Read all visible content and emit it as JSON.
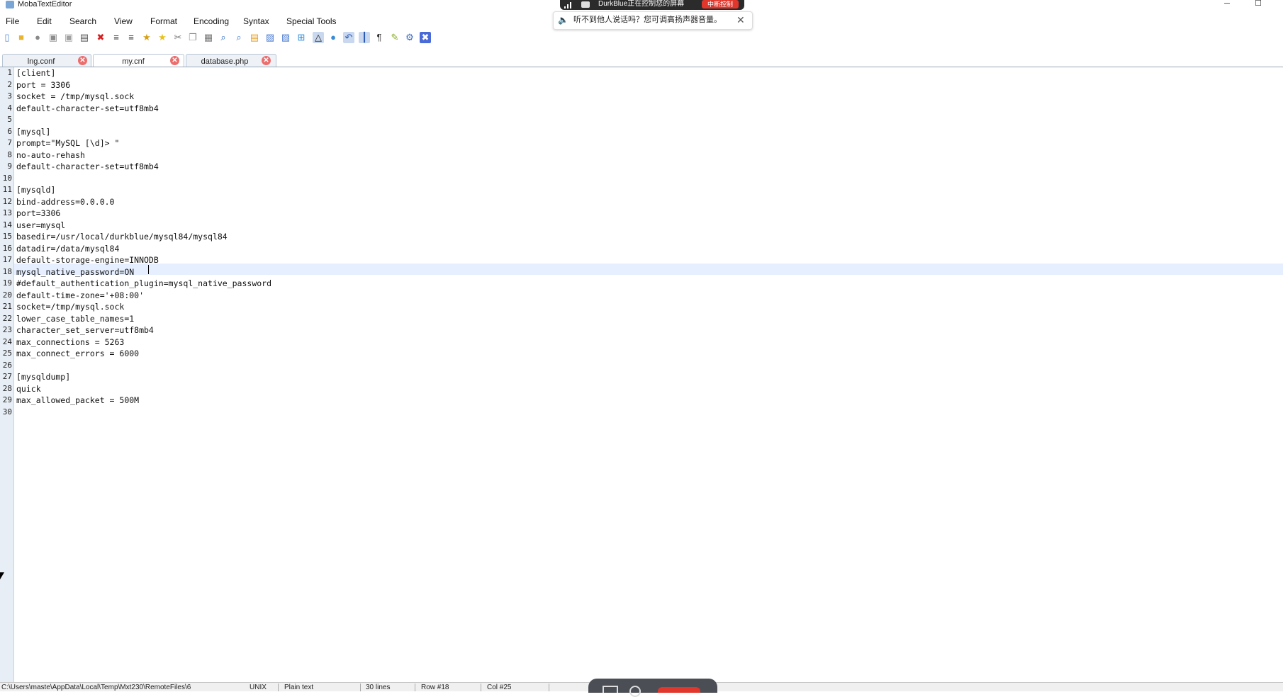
{
  "window": {
    "title": "MobaTextEditor",
    "minimize_glyph": "─",
    "maximize_glyph": "☐"
  },
  "screen_share": {
    "text": "DurkBlue正在控制您的屏幕",
    "stop_label": "中断控制"
  },
  "audio_notice": {
    "text": "听不到他人说话吗？您可调高扬声器音量。",
    "icon": "speaker-muted-icon",
    "icon_glyph": "🔈",
    "close_glyph": "✕"
  },
  "menu": [
    {
      "label": "File"
    },
    {
      "label": "Edit"
    },
    {
      "label": "Search"
    },
    {
      "label": "View"
    },
    {
      "label": "Format"
    },
    {
      "label": "Encoding"
    },
    {
      "label": "Syntax"
    },
    {
      "label": "Special Tools"
    }
  ],
  "toolbar": [
    {
      "name": "new-file-icon",
      "glyph": "▯",
      "color": "#5b8fd6"
    },
    {
      "name": "open-folder-icon",
      "glyph": "■",
      "color": "#e8b431"
    },
    {
      "name": "disk-icon",
      "glyph": "●",
      "color": "#8a8a8a"
    },
    {
      "name": "save-icon",
      "glyph": "▣",
      "color": "#8b8b8b"
    },
    {
      "name": "save-all-icon",
      "glyph": "▣",
      "color": "#a0a0a0"
    },
    {
      "name": "print-icon",
      "glyph": "▤",
      "color": "#555"
    },
    {
      "name": "close-file-icon",
      "glyph": "✖",
      "color": "#d42020"
    },
    {
      "name": "outdent-icon",
      "glyph": "≡",
      "color": "#333"
    },
    {
      "name": "indent-icon",
      "glyph": "≡",
      "color": "#333"
    },
    {
      "name": "bookmark-icon",
      "glyph": "★",
      "color": "#d4a017"
    },
    {
      "name": "bookmark-next-icon",
      "glyph": "★",
      "color": "#e8c020"
    },
    {
      "name": "cut-icon",
      "glyph": "✂",
      "color": "#777"
    },
    {
      "name": "copy-icon",
      "glyph": "❐",
      "color": "#888"
    },
    {
      "name": "paste-icon",
      "glyph": "▦",
      "color": "#777"
    },
    {
      "name": "find-icon",
      "glyph": "⌕",
      "color": "#2a6ac4"
    },
    {
      "name": "find-next-icon",
      "glyph": "⌕",
      "color": "#3a7ad4"
    },
    {
      "name": "replace-icon",
      "glyph": "▤",
      "color": "#e8a020"
    },
    {
      "name": "goto-icon",
      "glyph": "▨",
      "color": "#4a7ad0"
    },
    {
      "name": "compare-icon",
      "glyph": "▨",
      "color": "#4a7ad0"
    },
    {
      "name": "windows-eol-icon",
      "glyph": "⊞",
      "color": "#2a8ad4"
    },
    {
      "name": "linux-eol-icon",
      "glyph": "△",
      "color": "#222"
    },
    {
      "name": "mac-eol-icon",
      "glyph": "●",
      "color": "#3a8ad6"
    },
    {
      "name": "word-wrap-icon",
      "glyph": "↶",
      "color": "#2a5ab4"
    },
    {
      "name": "ruler-icon",
      "glyph": "┃",
      "color": "#2a5ab4"
    },
    {
      "name": "paragraph-icon",
      "glyph": "¶",
      "color": "#333"
    },
    {
      "name": "highlight-icon",
      "glyph": "✎",
      "color": "#8ab020"
    },
    {
      "name": "settings-icon",
      "glyph": "⚙",
      "color": "#3a6ac0"
    },
    {
      "name": "exit-icon",
      "glyph": "✖",
      "color": "#ffffff"
    }
  ],
  "tabs": [
    {
      "label": "lng.conf",
      "active": false
    },
    {
      "label": "my.cnf",
      "active": true
    },
    {
      "label": "database.php",
      "active": false
    }
  ],
  "tab_close_glyph": "✕",
  "editor": {
    "current_line": 18,
    "lines": [
      "[client]",
      "port = 3306",
      "socket = /tmp/mysql.sock",
      "default-character-set=utf8mb4",
      "",
      "[mysql]",
      "prompt=\"MySQL [\\d]> \"",
      "no-auto-rehash",
      "default-character-set=utf8mb4",
      "",
      "[mysqld]",
      "bind-address=0.0.0.0",
      "port=3306",
      "user=mysql",
      "basedir=/usr/local/durkblue/mysql84/mysql84",
      "datadir=/data/mysql84",
      "default-storage-engine=INNODB",
      "mysql_native_password=ON",
      "#default_authentication_plugin=mysql_native_password",
      "default-time-zone='+08:00'",
      "socket=/tmp/mysql.sock",
      "lower_case_table_names=1",
      "character_set_server=utf8mb4",
      "max_connections = 5263",
      "max_connect_errors = 6000",
      "",
      "[mysqldump]",
      "quick",
      "max_allowed_packet = 500M",
      ""
    ]
  },
  "status": {
    "path": "C:\\Users\\maste\\AppData\\Local\\Temp\\Mxt230\\RemoteFiles\\6",
    "eol": "UNIX",
    "syntax": "Plain text",
    "line_count": "30 lines",
    "row": "Row #18",
    "col": "Col #25"
  }
}
